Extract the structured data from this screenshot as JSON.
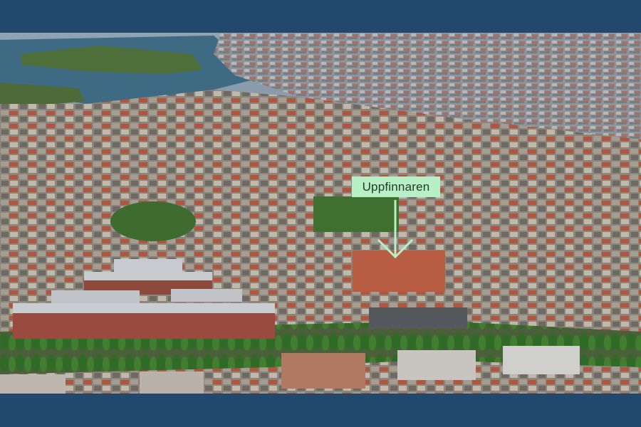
{
  "photo": {
    "subject": "aerial-city-view",
    "colors": {
      "frame": "#22496c",
      "water": "#3f6a84",
      "sky_haze": "#7b95a8",
      "rooftops": "#8b8580",
      "red_roofs": "#b0513c",
      "greenery": "#3d6b2f",
      "callout_fill": "#b8f0c6"
    }
  },
  "marker": {
    "label": "Uppfinnaren",
    "arrow_icon": "down-arrow-icon"
  }
}
